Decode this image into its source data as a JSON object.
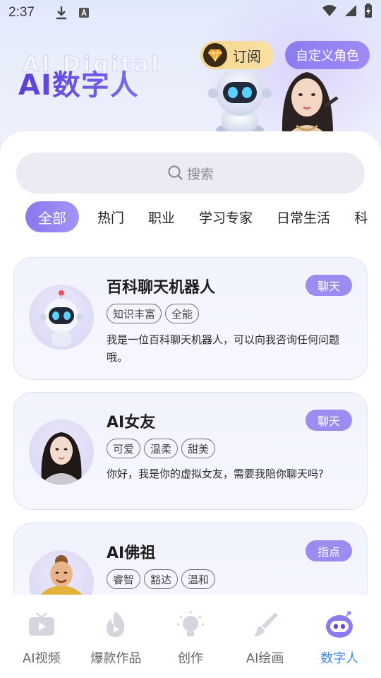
{
  "status_bar": {
    "time": "2:37"
  },
  "header": {
    "title": "AI数字人",
    "ghost_text": "AI Digital",
    "subscribe_label": "订阅",
    "custom_role_label": "自定义角色"
  },
  "search": {
    "placeholder": "搜索"
  },
  "tabs": [
    {
      "label": "全部",
      "active": true
    },
    {
      "label": "热门"
    },
    {
      "label": "职业"
    },
    {
      "label": "学习专家"
    },
    {
      "label": "日常生活"
    },
    {
      "label": "科"
    }
  ],
  "cards": [
    {
      "name": "百科聊天机器人",
      "badge": "聊天",
      "tags": [
        "知识丰富",
        "全能"
      ],
      "description": "我是一位百科聊天机器人，可以向我咨询任何问题哦。",
      "avatar_icon": "robot-avatar"
    },
    {
      "name": "AI女友",
      "badge": "聊天",
      "tags": [
        "可爱",
        "温柔",
        "甜美"
      ],
      "description": "你好，我是你的虚拟女友，需要我陪你聊天吗?",
      "avatar_icon": "girl-avatar"
    },
    {
      "name": "AI佛祖",
      "badge": "指点",
      "tags": [
        "睿智",
        "豁达",
        "温和"
      ],
      "description": "",
      "avatar_icon": "buddha-avatar"
    }
  ],
  "bottom_nav": [
    {
      "label": "AI视频",
      "icon": "video-icon"
    },
    {
      "label": "爆款作品",
      "icon": "fire-icon"
    },
    {
      "label": "创作",
      "icon": "bulb-icon"
    },
    {
      "label": "AI绘画",
      "icon": "brush-icon"
    },
    {
      "label": "数字人",
      "icon": "robot-icon",
      "active": true
    }
  ],
  "colors": {
    "accent_purple": "#9b8cf0",
    "active_nav": "#3b87e8",
    "vip_gold": "#f6d58a"
  }
}
